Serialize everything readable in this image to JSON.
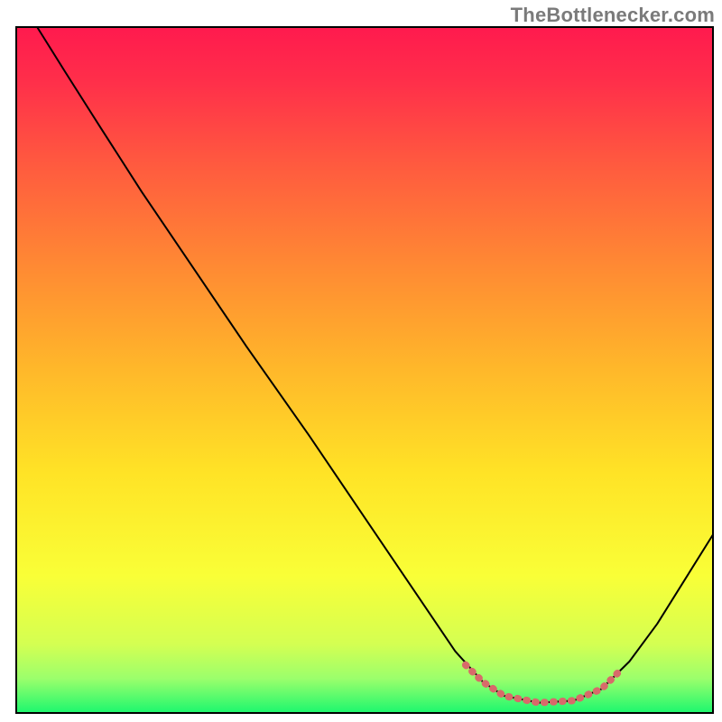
{
  "attribution": "TheBottlenecker.com",
  "chart_data": {
    "type": "line",
    "title": "",
    "xlabel": "",
    "ylabel": "",
    "xlim": [
      0,
      100
    ],
    "ylim": [
      0,
      100
    ],
    "grid": false,
    "legend": false,
    "background_gradient_stops": [
      {
        "offset": 0.0,
        "color": "#ff1a4e"
      },
      {
        "offset": 0.08,
        "color": "#ff2f4a"
      },
      {
        "offset": 0.2,
        "color": "#ff5a3f"
      },
      {
        "offset": 0.35,
        "color": "#ff8a33"
      },
      {
        "offset": 0.5,
        "color": "#ffb82a"
      },
      {
        "offset": 0.65,
        "color": "#ffe326"
      },
      {
        "offset": 0.8,
        "color": "#f9ff37"
      },
      {
        "offset": 0.9,
        "color": "#d4ff52"
      },
      {
        "offset": 0.95,
        "color": "#9bff6c"
      },
      {
        "offset": 1.0,
        "color": "#1cf76e"
      }
    ],
    "series": [
      {
        "name": "curve",
        "color": "#000000",
        "stroke_width": 2,
        "points": [
          {
            "x": 3.0,
            "y": 100.0
          },
          {
            "x": 7.0,
            "y": 93.5
          },
          {
            "x": 12.0,
            "y": 85.5
          },
          {
            "x": 18.0,
            "y": 76.0
          },
          {
            "x": 25.0,
            "y": 65.5
          },
          {
            "x": 33.0,
            "y": 53.5
          },
          {
            "x": 42.0,
            "y": 40.5
          },
          {
            "x": 50.0,
            "y": 28.5
          },
          {
            "x": 58.0,
            "y": 16.5
          },
          {
            "x": 63.0,
            "y": 9.0
          },
          {
            "x": 67.0,
            "y": 4.5
          },
          {
            "x": 70.0,
            "y": 2.5
          },
          {
            "x": 75.0,
            "y": 1.5
          },
          {
            "x": 80.0,
            "y": 1.8
          },
          {
            "x": 84.0,
            "y": 3.5
          },
          {
            "x": 88.0,
            "y": 7.5
          },
          {
            "x": 92.0,
            "y": 13.0
          },
          {
            "x": 96.0,
            "y": 19.5
          },
          {
            "x": 100.0,
            "y": 26.0
          }
        ]
      },
      {
        "name": "optimal-range-marker",
        "color": "#d86a6a",
        "stroke_width": 8,
        "dash": "1 9",
        "linecap": "round",
        "points": [
          {
            "x": 64.5,
            "y": 7.0
          },
          {
            "x": 67.0,
            "y": 4.5
          },
          {
            "x": 70.0,
            "y": 2.5
          },
          {
            "x": 75.0,
            "y": 1.5
          },
          {
            "x": 80.0,
            "y": 1.8
          },
          {
            "x": 84.0,
            "y": 3.5
          },
          {
            "x": 87.0,
            "y": 6.5
          }
        ]
      }
    ],
    "annotations": []
  }
}
